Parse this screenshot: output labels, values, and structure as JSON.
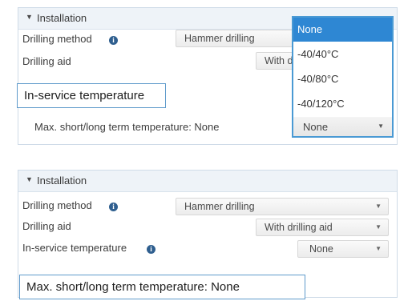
{
  "top": {
    "header": {
      "title": "Installation"
    },
    "drilling_method": {
      "label": "Drilling method",
      "value": "Hammer drilling"
    },
    "drilling_aid": {
      "label": "Drilling aid",
      "value": "With d"
    },
    "callout": "In-service temperature",
    "max_temp": {
      "label": "Max. short/long term temperature: None"
    },
    "dropdown": {
      "options": [
        "None",
        "-40/40°C",
        "-40/80°C",
        "-40/120°C"
      ],
      "selected_index": 0,
      "current_value": "None"
    }
  },
  "bottom": {
    "header": {
      "title": "Installation"
    },
    "drilling_method": {
      "label": "Drilling method",
      "value": "Hammer drilling"
    },
    "drilling_aid": {
      "label": "Drilling aid",
      "value": "With drilling aid"
    },
    "in_service": {
      "label": "In-service temperature",
      "value": "None"
    },
    "callout": "Max. short/long term temperature: None"
  },
  "icons": {
    "info": "info-icon",
    "expand": "triangle-down-icon",
    "dropdown": "chevron-down-icon"
  },
  "colors": {
    "accent": "#2e87d3",
    "border": "#4a9ad4",
    "info": "#2f5f8f"
  }
}
